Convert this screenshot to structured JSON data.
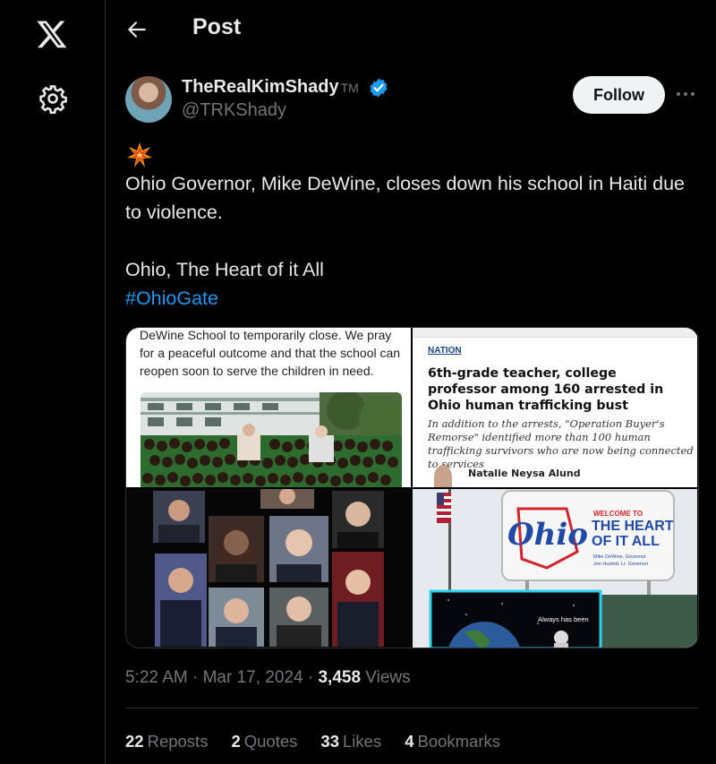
{
  "page": {
    "title": "Post"
  },
  "sidebar": {
    "logo": "x-logo-icon",
    "settings_icon": "gear-icon"
  },
  "author": {
    "display_name": "TheRealKimShady",
    "tm": "TM",
    "handle": "@TRKShady",
    "verified": true,
    "follow_label": "Follow"
  },
  "post": {
    "emoji": "💥",
    "line1": "Ohio Governor, Mike DeWine, closes down his school in Haiti due to violence.",
    "line2": "Ohio, The Heart of it All",
    "hashtag": "#OhioGate"
  },
  "media": {
    "img1_caption": "DeWine School to temporarily close. We pray for a peaceful outcome and that the school can reopen soon to serve the children in need.",
    "img2_section": "NATION",
    "img2_headline": "6th-grade teacher, college professor among 160 arrested in Ohio human trafficking bust",
    "img2_subhead": "In addition to the arrests, \"Operation Buyer's Remorse\" identified more than 100 human trafficking survivors who are now being connected to services",
    "img2_author": "Natalie Neysa Alund",
    "img4_sign_ohio": "Ohio",
    "img4_sign_welcome": "WELCOME TO",
    "img4_sign_heart": "THE HEART",
    "img4_sign_all": "OF IT ALL",
    "img4_sign_credit1": "Mike DeWine, Governor",
    "img4_sign_credit2": "Jon Husted, Lt. Governor",
    "img4_overlay": "Always has been"
  },
  "meta": {
    "time": "5:22 AM",
    "date": "Mar 17, 2024",
    "views_count": "3,458",
    "views_label": "Views"
  },
  "stats": {
    "reposts_count": "22",
    "reposts_label": "Reposts",
    "quotes_count": "2",
    "quotes_label": "Quotes",
    "likes_count": "33",
    "likes_label": "Likes",
    "bookmarks_count": "4",
    "bookmarks_label": "Bookmarks"
  },
  "colors": {
    "accent": "#1d9bf0",
    "muted": "#71767b",
    "text": "#e7e9ea",
    "background": "#000000"
  }
}
